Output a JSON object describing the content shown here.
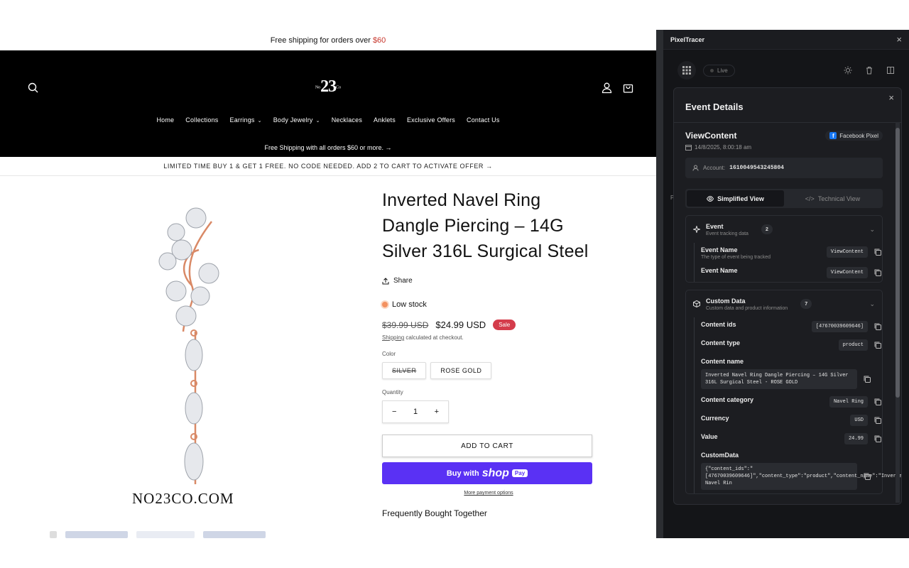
{
  "store": {
    "announcement": {
      "text": "Free shipping for orders over",
      "price": "$60"
    },
    "logo": {
      "main": "23",
      "left": "No",
      "right": "Co"
    },
    "nav": [
      {
        "label": "Home",
        "has_caret": false
      },
      {
        "label": "Collections",
        "has_caret": false
      },
      {
        "label": "Earrings",
        "has_caret": true
      },
      {
        "label": "Body Jewelry",
        "has_caret": true
      },
      {
        "label": "Necklaces",
        "has_caret": false
      },
      {
        "label": "Anklets",
        "has_caret": false
      },
      {
        "label": "Exclusive Offers",
        "has_caret": false
      },
      {
        "label": "Contact Us",
        "has_caret": false
      }
    ],
    "shipping_note": "Free Shipping with all orders $60 or more. →",
    "promo": "LIMITED TIME BUY 1 & GET 1 FREE. NO CODE NEEDED. ADD 2 TO CART TO ACTIVATE OFFER →",
    "brand_word": "NO23CO.COM",
    "product": {
      "title": "Inverted Navel Ring Dangle Piercing – 14G Silver 316L Surgical Steel",
      "share": "Share",
      "stock": "Low stock",
      "old_price": "$39.99 USD",
      "new_price": "$24.99 USD",
      "sale_badge": "Sale",
      "shipping_link": "Shipping",
      "shipping_rest": " calculated at checkout.",
      "color_label": "Color",
      "colors": [
        {
          "label": "SILVER",
          "unavailable": true
        },
        {
          "label": "ROSE GOLD",
          "unavailable": false
        }
      ],
      "quantity_label": "Quantity",
      "quantity": "1",
      "minus": "−",
      "plus": "+",
      "add_to_cart": "ADD TO CART",
      "buy_with": "Buy with",
      "shop": "shop",
      "pay": "Pay",
      "more_payment": "More payment options",
      "fbt": "Frequently Bought Together"
    }
  },
  "panel": {
    "title": "PixelTracer",
    "live": "Live",
    "modal_title": "Event Details",
    "event_name": "ViewContent",
    "pixel": "Facebook Pixel",
    "timestamp": "14/8/2025, 8:00:18 am",
    "account_label": "Account:",
    "account_id": "1610049543245804",
    "views": [
      "Simplified View",
      "Technical View"
    ],
    "side_letter": "P",
    "sections": {
      "event": {
        "title": "Event",
        "subtitle": "Event tracking data",
        "count": "2",
        "rows": [
          {
            "label": "Event Name",
            "desc": "The type of event being tracked",
            "value": "ViewContent"
          },
          {
            "label": "Event Name",
            "desc": "",
            "value": "ViewContent"
          }
        ]
      },
      "custom": {
        "title": "Custom Data",
        "subtitle": "Custom data and product information",
        "count": "7",
        "rows": [
          {
            "label": "Content ids",
            "value": "[47670039609646]"
          },
          {
            "label": "Content type",
            "value": "product"
          },
          {
            "label": "Content name",
            "value": "Inverted Navel Ring Dangle Piercing – 14G Silver 316L Surgical Steel - ROSE GOLD"
          },
          {
            "label": "Content category",
            "value": "Navel Ring"
          },
          {
            "label": "Currency",
            "value": "USD"
          },
          {
            "label": "Value",
            "value": "24.99"
          },
          {
            "label": "CustomData",
            "value": "{\"content_ids\":\"[47670039609646]\",\"content_type\":\"product\",\"content_name\":\"Inverted Navel Rin"
          }
        ]
      }
    }
  },
  "colors": {
    "sale": "#d43c4b",
    "shop_pay": "#5a31f4",
    "stock_dot": "#f39160",
    "panel_bg": "#141518",
    "facebook": "#1877f2"
  }
}
